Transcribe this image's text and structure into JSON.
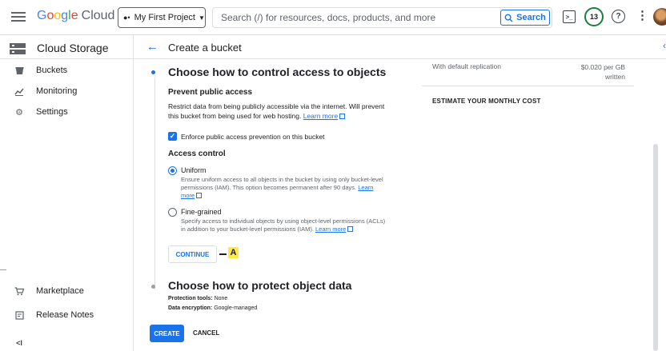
{
  "header": {
    "logo_google": "Google",
    "logo_cloud": "Cloud",
    "project": "My First Project",
    "search_placeholder": "Search (/) for resources, docs, products, and more",
    "search_button": "Search",
    "terminal_icon": ">_",
    "notification_count": "13",
    "help_icon": "?"
  },
  "sidebar": {
    "title": "Cloud Storage",
    "items": [
      {
        "label": "Buckets",
        "icon": "bucket-icon"
      },
      {
        "label": "Monitoring",
        "icon": "monitoring-icon"
      },
      {
        "label": "Settings",
        "icon": "gear-icon"
      }
    ],
    "bottom_items": [
      {
        "label": "Marketplace",
        "icon": "cart-icon"
      },
      {
        "label": "Release Notes",
        "icon": "notes-icon"
      }
    ],
    "collapse_icon": "<I"
  },
  "page": {
    "title": "Create a bucket"
  },
  "access": {
    "section_title": "Choose how to control access to objects",
    "prevent_title": "Prevent public access",
    "prevent_text_1": "Restrict data from being publicly accessible via the internet. Will prevent",
    "prevent_text_2": "this bucket from being used for web hosting.",
    "learn_more": "Learn more",
    "enforce_label": "Enforce public access prevention on this bucket",
    "access_control_title": "Access control",
    "uniform_label": "Uniform",
    "uniform_desc_1": "Ensure uniform access to all objects in the bucket by using only bucket-level",
    "uniform_desc_2": "permissions (IAM). This option becomes permanent after 90 days.",
    "uniform_learn": "Learn",
    "uniform_more": "more",
    "fine_label": "Fine-grained",
    "fine_desc_1": "Specify access to individual objects by using object-level permissions (ACLs)",
    "fine_desc_2": "in addition to your bucket-level permissions (IAM).",
    "fine_learn_more": "Learn more",
    "continue": "CONTINUE",
    "marker": "A"
  },
  "protect": {
    "section_title": "Choose how to protect object data",
    "tools_label": "Protection tools:",
    "tools_value": "None",
    "encryption_label": "Data encryption:",
    "encryption_value": "Google-managed"
  },
  "actions": {
    "create": "CREATE",
    "cancel": "CANCEL"
  },
  "cost_panel": {
    "replication_label": "With default replication",
    "price_line_1": "$0.020 per GB",
    "price_line_2": "written",
    "estimate": "ESTIMATE YOUR MONTHLY COST"
  },
  "colors": {
    "accent": "#1a73e8",
    "notification_ring": "#188038",
    "marker": "#ffeb3b"
  }
}
